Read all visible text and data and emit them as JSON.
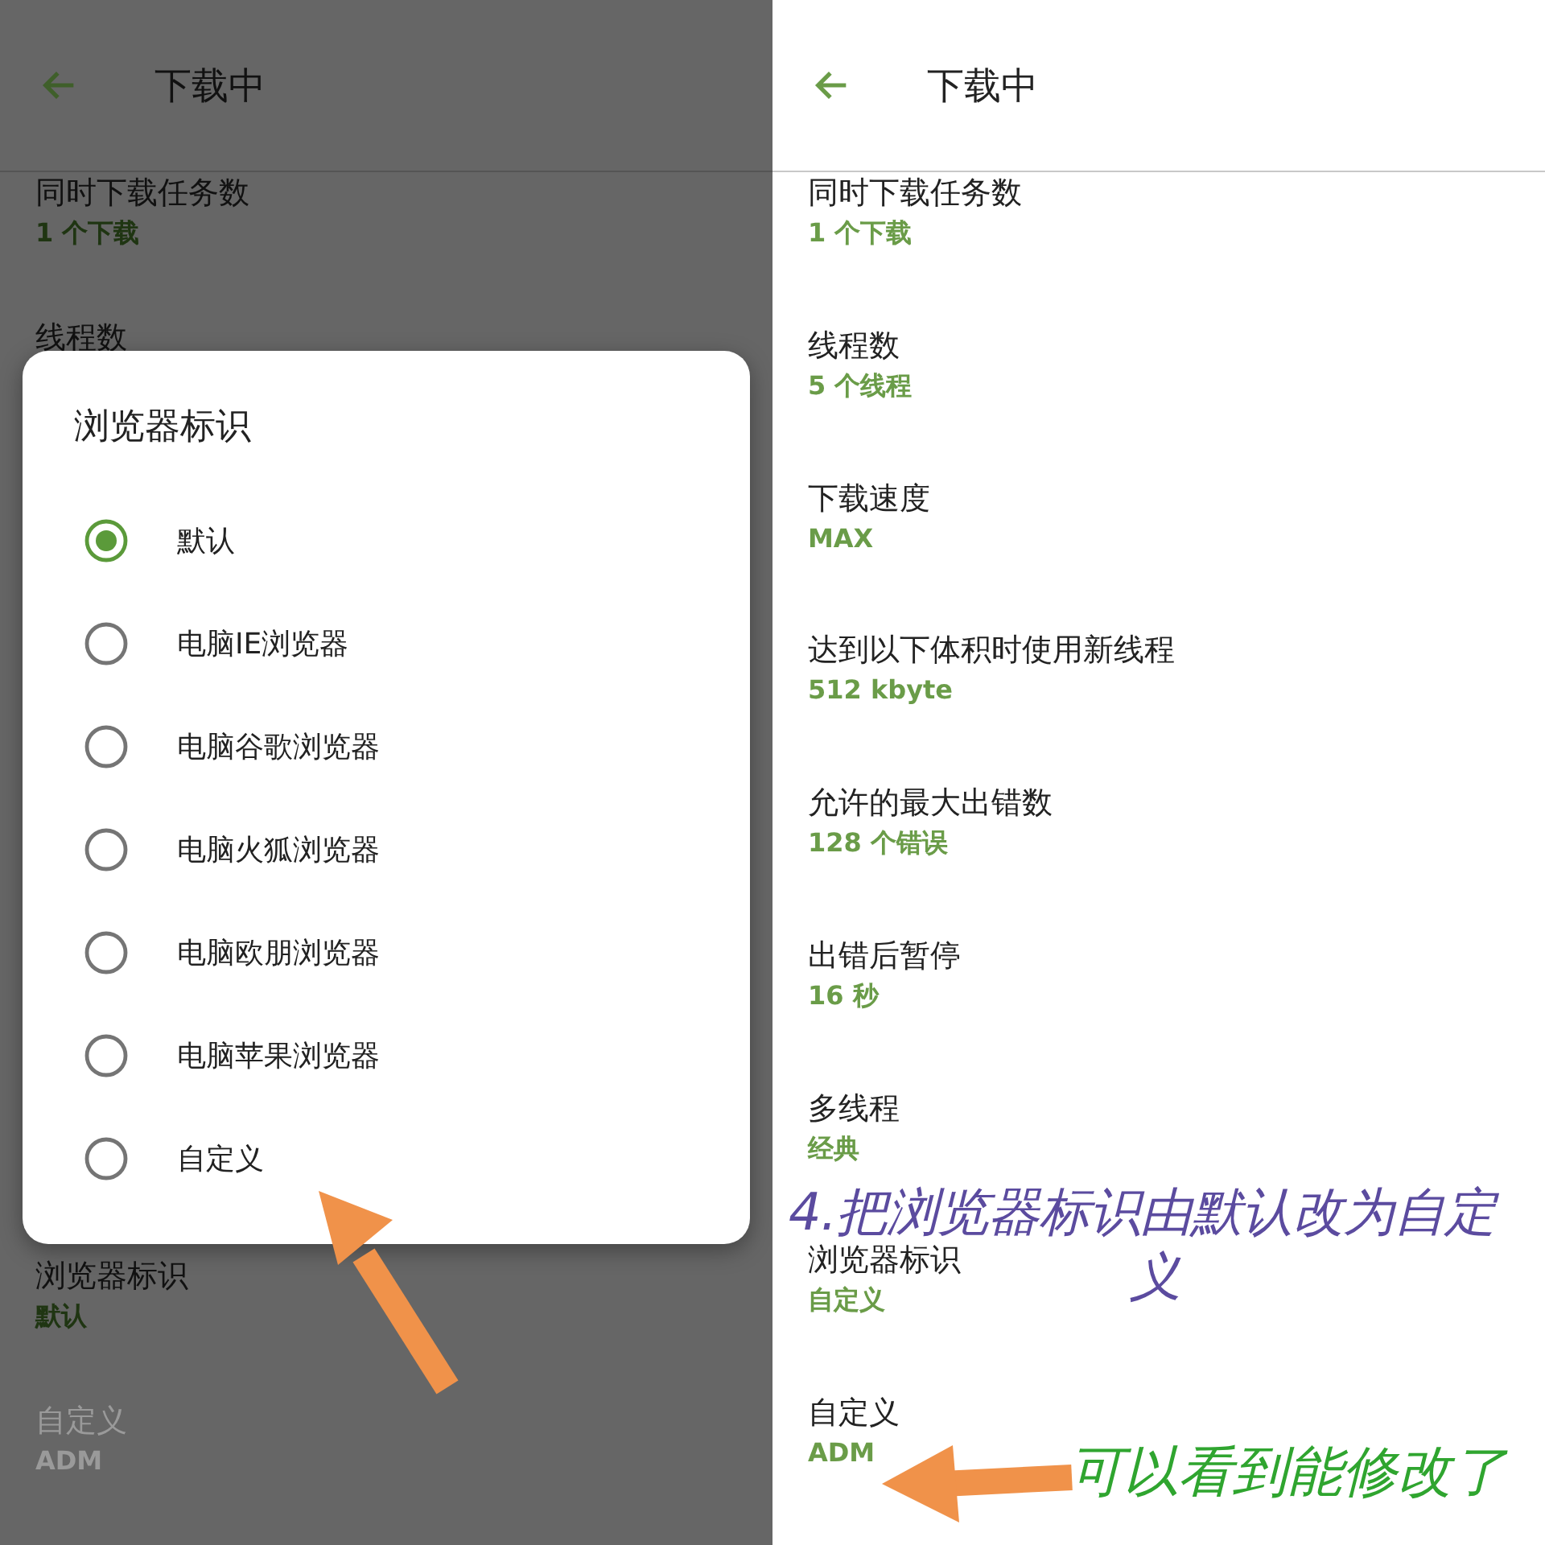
{
  "left_screen": {
    "header": {
      "title": "下载中"
    },
    "settings_top": [
      {
        "title": "同时下载任务数",
        "value": "1 个下载",
        "disabled": false
      },
      {
        "title": "线程数",
        "disabled": false
      }
    ],
    "settings_bottom": [
      {
        "title": "浏览器标识",
        "value": "默认",
        "disabled": false
      },
      {
        "title": "自定义",
        "value": "ADM",
        "disabled": true
      }
    ],
    "dialog": {
      "title": "浏览器标识",
      "options": [
        {
          "label": "默认",
          "selected": true
        },
        {
          "label": "电脑IE浏览器",
          "selected": false
        },
        {
          "label": "电脑谷歌浏览器",
          "selected": false
        },
        {
          "label": "电脑火狐浏览器",
          "selected": false
        },
        {
          "label": "电脑欧朋浏览器",
          "selected": false
        },
        {
          "label": "电脑苹果浏览器",
          "selected": false
        },
        {
          "label": "自定义",
          "selected": false
        }
      ]
    }
  },
  "right_screen": {
    "header": {
      "title": "下载中"
    },
    "settings": [
      {
        "title": "同时下载任务数",
        "value": "1 个下载",
        "disabled": false
      },
      {
        "title": "线程数",
        "value": "5 个线程",
        "disabled": false
      },
      {
        "title": "下载速度",
        "value": "MAX",
        "disabled": false
      },
      {
        "title": "达到以下体积时使用新线程",
        "value": "512 kbyte",
        "disabled": false
      },
      {
        "title": "允许的最大出错数",
        "value": "128 个错误",
        "disabled": false
      },
      {
        "title": "出错后暂停",
        "value": "16 秒",
        "disabled": false
      },
      {
        "title": "多线程",
        "value": "经典",
        "disabled": false
      },
      {
        "title": "浏览器标识",
        "value": "自定义",
        "disabled": false
      },
      {
        "title": "自定义",
        "value": "ADM",
        "disabled": false
      }
    ]
  },
  "annotations": [
    {
      "text": "4.把浏览器标识由默认改为自定",
      "color": "#5b4b9f"
    },
    {
      "text": "义",
      "color": "#5b4b9f"
    },
    {
      "text": "可以看到能修改了",
      "color": "#2fa52f"
    }
  ]
}
